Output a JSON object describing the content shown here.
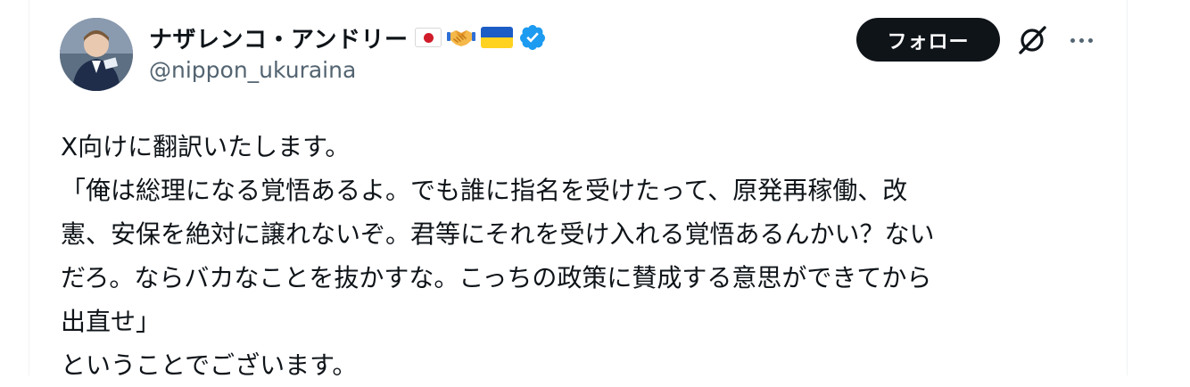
{
  "user": {
    "display_name": "ナザレンコ・アンドリー",
    "handle": "@nippon_ukuraina",
    "badges": [
      "flag-japan-icon",
      "handshake-icon",
      "flag-ukraine-icon",
      "verified-badge-icon"
    ]
  },
  "actions": {
    "follow_label": "フォロー",
    "grok_icon": "grok-icon",
    "more_icon": "more-options-icon"
  },
  "tweet": {
    "lines": [
      "X向けに翻訳いたします。",
      "「俺は総理になる覚悟あるよ。でも誰に指名を受けたって、原発再稼働、改",
      "憲、安保を絶対に譲れないぞ。君等にそれを受け入れる覚悟あるんかい？ない",
      "だろ。ならバカなことを抜かすな。こっちの政策に賛成する意思ができてから",
      "出直せ」",
      "ということでございます。"
    ]
  },
  "colors": {
    "text_primary": "#0f1419",
    "text_secondary": "#536471",
    "verified_blue": "#1d9bf0",
    "follow_bg": "#0f1419",
    "follow_text": "#ffffff"
  }
}
